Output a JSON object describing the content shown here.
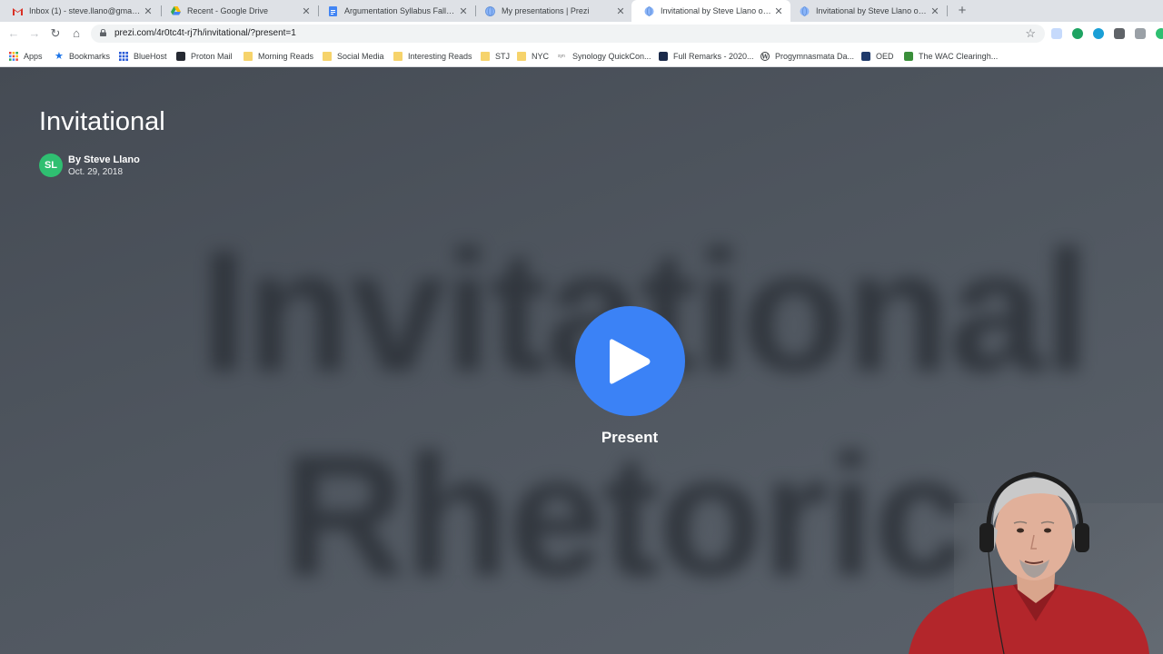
{
  "tabs": [
    {
      "title": "Inbox (1) - steve.llano@gmail.com",
      "icon": "gmail-icon",
      "active": false
    },
    {
      "title": "Recent - Google Drive",
      "icon": "google-drive-icon",
      "active": false
    },
    {
      "title": "Argumentation Syllabus Fall 2020",
      "icon": "google-docs-icon",
      "active": false
    },
    {
      "title": "My presentations | Prezi",
      "icon": "globe-icon",
      "active": false
    },
    {
      "title": "Invitational by Steve Llano on Prezi",
      "icon": "globe-icon",
      "active": true
    },
    {
      "title": "Invitational by Steve Llano on Prezi",
      "icon": "globe-icon",
      "active": false
    }
  ],
  "address_bar": {
    "url": "prezi.com/4r0tc4t-rj7h/invitational/?present=1"
  },
  "bookmarks": [
    {
      "label": "Apps",
      "icon": "apps-grid-icon"
    },
    {
      "label": "Bookmarks",
      "icon": "star-icon"
    },
    {
      "label": "BlueHost",
      "icon": "bluehost-icon"
    },
    {
      "label": "Proton Mail",
      "icon": "protonmail-icon"
    },
    {
      "label": "Morning Reads",
      "icon": "folder-icon"
    },
    {
      "label": "Social Media",
      "icon": "folder-icon"
    },
    {
      "label": "Interesting Reads",
      "icon": "folder-icon"
    },
    {
      "label": "STJ",
      "icon": "folder-icon"
    },
    {
      "label": "NYC",
      "icon": "folder-icon"
    },
    {
      "label": "Synology QuickCon...",
      "icon": "synology-icon"
    },
    {
      "label": "Full Remarks - 2020...",
      "icon": "site-icon"
    },
    {
      "label": "Progymnasmata Da...",
      "icon": "wordpress-icon"
    },
    {
      "label": "OED",
      "icon": "oed-icon"
    },
    {
      "label": "The WAC Clearingh...",
      "icon": "wac-icon"
    }
  ],
  "presentation": {
    "title": "Invitational",
    "author": "By Steve Llano",
    "date": "Oct. 29, 2018",
    "avatar_initials": "SL",
    "background_text_line1": "Invitational",
    "background_text_line2": "Rhetoric",
    "present_label": "Present"
  },
  "colors": {
    "play_button": "#3b82f6",
    "avatar": "#2fbf71",
    "background": "#4a5058"
  }
}
